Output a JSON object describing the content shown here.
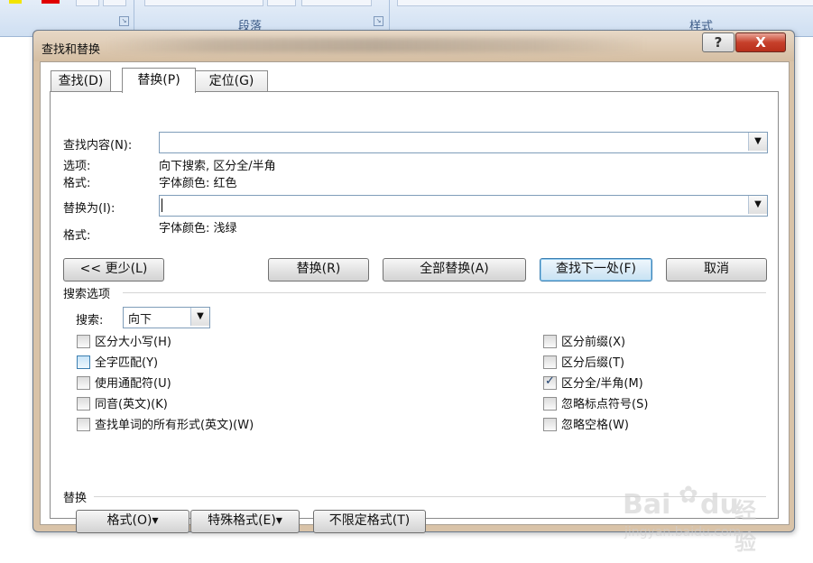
{
  "ribbon": {
    "paragraph_group": "段落",
    "styles_group": "样式",
    "launcher_icon": "dialog-launcher-icon"
  },
  "dialog": {
    "title": "查找和替换",
    "help_label": "?",
    "close_label": "X",
    "tabs": [
      {
        "label": "查找(D)",
        "active": false
      },
      {
        "label": "替换(P)",
        "active": true
      },
      {
        "label": "定位(G)",
        "active": false
      }
    ],
    "find": {
      "label": "查找内容(N):",
      "value": "",
      "options_label": "选项:",
      "options_value": "向下搜索, 区分全/半角",
      "format_label": "格式:",
      "format_value": "字体颜色: 红色"
    },
    "replace": {
      "label": "替换为(I):",
      "value": "",
      "format_label": "格式:",
      "format_value": "字体颜色: 浅绿"
    },
    "buttons": {
      "less": "<< 更少(L)",
      "replace": "替换(R)",
      "replace_all": "全部替换(A)",
      "find_next": "查找下一处(F)",
      "cancel": "取消"
    },
    "search_options": {
      "heading": "搜索选项",
      "search_label": "搜索:",
      "search_value": "向下",
      "left_options": [
        {
          "label": "区分大小写(H)",
          "checked": false
        },
        {
          "label": "全字匹配(Y)",
          "checked": false
        },
        {
          "label": "使用通配符(U)",
          "checked": false
        },
        {
          "label": "同音(英文)(K)",
          "checked": false
        },
        {
          "label": "查找单词的所有形式(英文)(W)",
          "checked": false
        }
      ],
      "right_options": [
        {
          "label": "区分前缀(X)",
          "checked": false
        },
        {
          "label": "区分后缀(T)",
          "checked": false
        },
        {
          "label": "区分全/半角(M)",
          "checked": true
        },
        {
          "label": "忽略标点符号(S)",
          "checked": false
        },
        {
          "label": "忽略空格(W)",
          "checked": false
        }
      ]
    },
    "replace_section": {
      "heading": "替换",
      "format_button": "格式(O)▾",
      "special_button": "特殊格式(E)▾",
      "no_format_button": "不限定格式(T)"
    }
  },
  "watermark": {
    "brand": "Bai",
    "brand2": "du",
    "jingyan": "经验",
    "url": "jingyan.baidu.com"
  }
}
